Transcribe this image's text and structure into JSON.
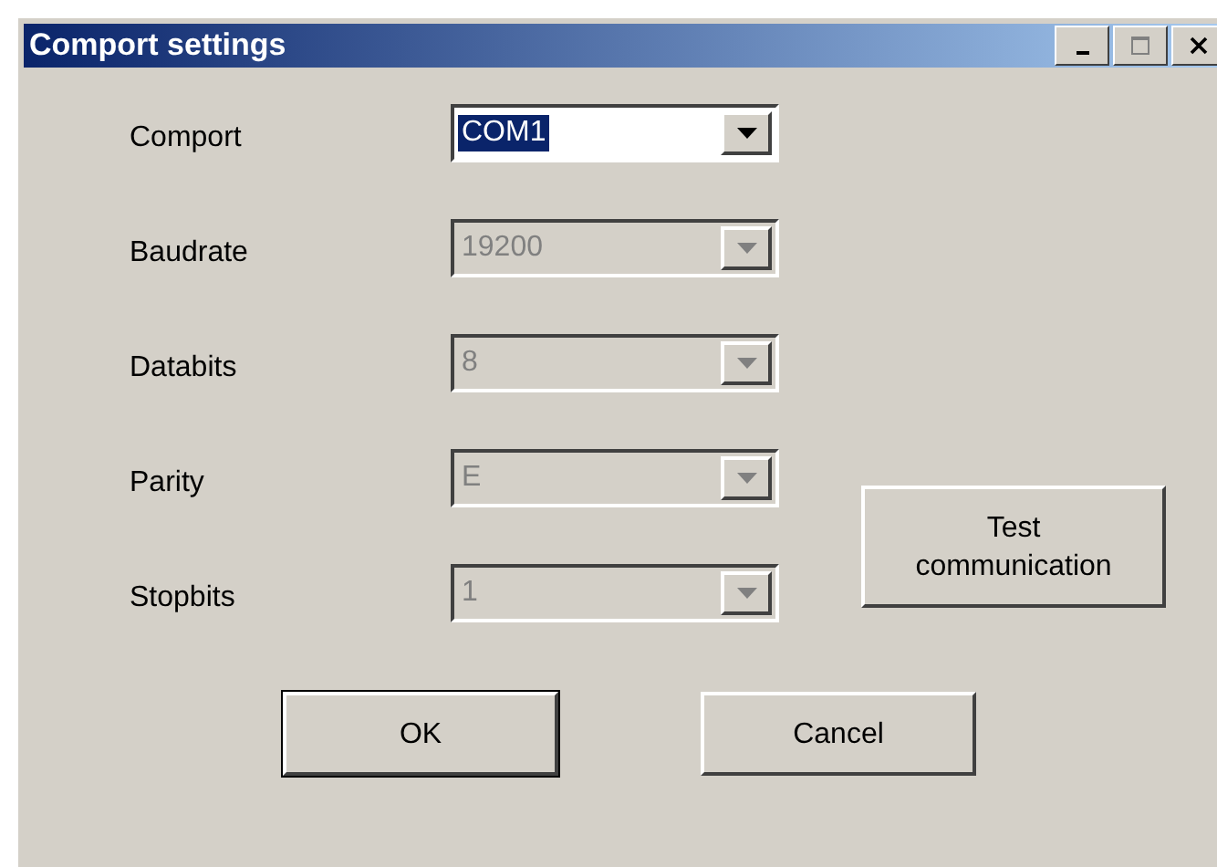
{
  "window": {
    "title": "Comport settings"
  },
  "fields": [
    {
      "label": "Comport",
      "value": "COM1",
      "disabled": false,
      "selected": true
    },
    {
      "label": "Baudrate",
      "value": "19200",
      "disabled": true,
      "selected": false
    },
    {
      "label": "Databits",
      "value": "8",
      "disabled": true,
      "selected": false
    },
    {
      "label": "Parity",
      "value": "E",
      "disabled": true,
      "selected": false
    },
    {
      "label": "Stopbits",
      "value": "1",
      "disabled": true,
      "selected": false
    }
  ],
  "test_button": {
    "label": "Test communication"
  },
  "buttons": [
    {
      "label": "OK",
      "default": true
    },
    {
      "label": "Cancel",
      "default": false
    }
  ]
}
